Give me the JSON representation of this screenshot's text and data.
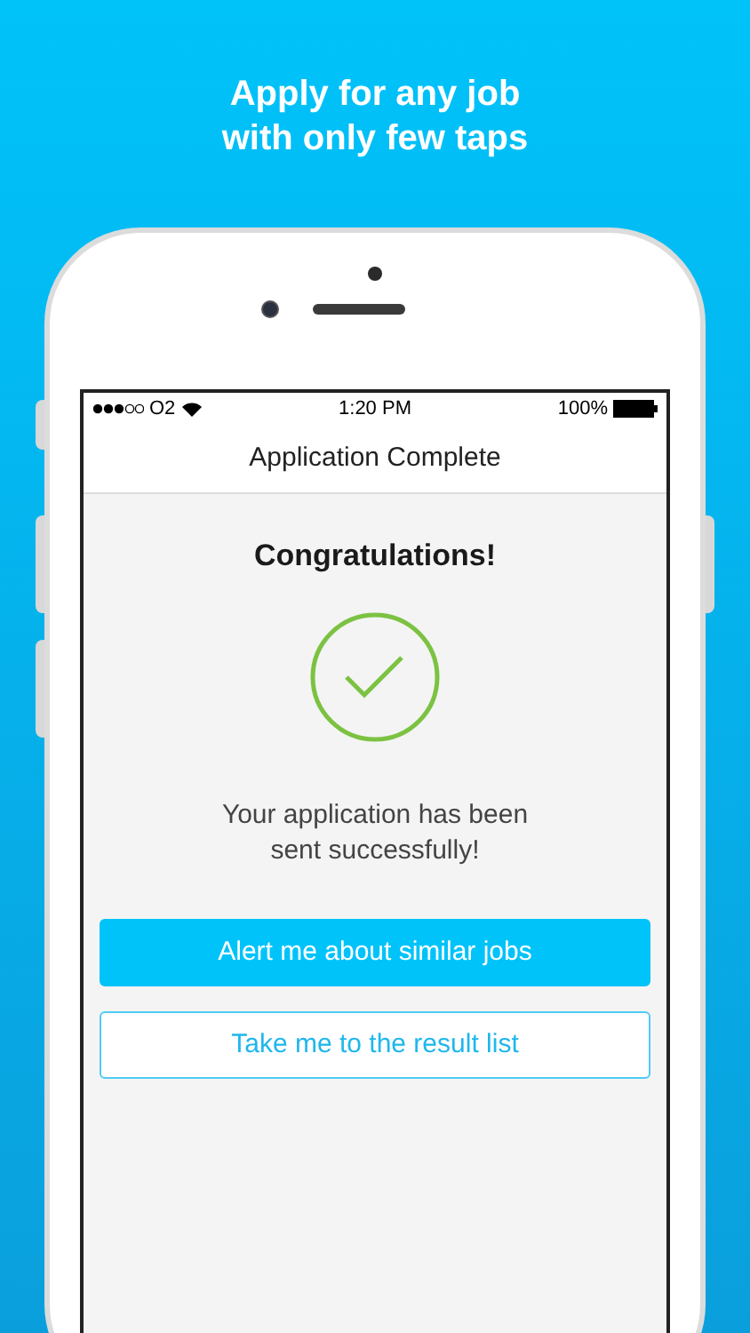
{
  "headline": [
    "Apply for any job",
    "with only few taps"
  ],
  "status_bar": {
    "carrier": "O2",
    "time": "1:20 PM",
    "battery": "100%"
  },
  "nav_bar": {
    "title": "Application Complete"
  },
  "heading": "Congratulations!",
  "message": [
    "Your application has been",
    "sent successfully!"
  ],
  "buttons": [
    {
      "label": "Alert me about similar jobs",
      "kind": "primary"
    },
    {
      "label": "Take me to the result list",
      "kind": "secondary"
    }
  ]
}
